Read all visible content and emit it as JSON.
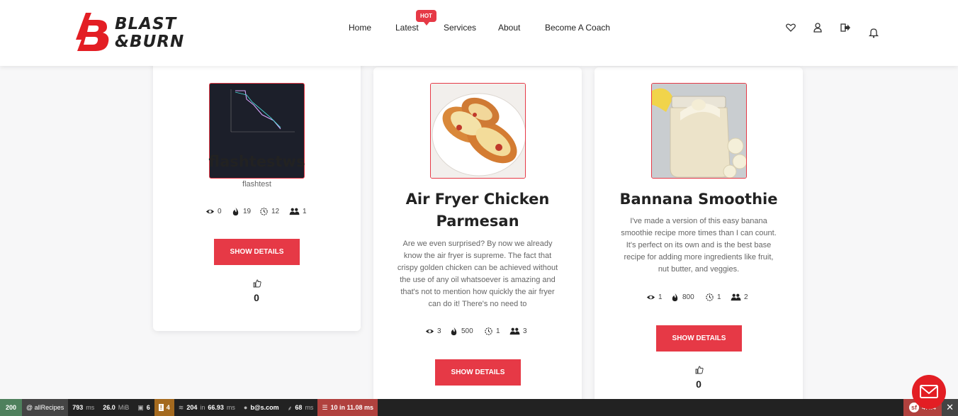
{
  "header": {
    "logo_text_1": "BLAST",
    "logo_text_2": "&BURN",
    "nav": [
      "Home",
      "Latest",
      "Services",
      "About",
      "Become A Coach"
    ],
    "hot_badge": "HOT",
    "icons": [
      "heart-icon",
      "user-icon",
      "logout-icon",
      "bell-icon"
    ]
  },
  "cards": [
    {
      "title": "flashtestws",
      "subtitle": "flashtest",
      "views": "0",
      "calories": "19",
      "time": "12",
      "people": "1",
      "button": "SHOW DETAILS",
      "likes": "0"
    },
    {
      "title_line1": "Air Fryer Chicken",
      "title_line2": "Parmesan",
      "desc": [
        "Are we even surprised? By now we already",
        "know the air fryer is supreme. The fact that",
        "crispy golden chicken can be achieved without",
        "the use of any oil whatsoever is amazing and",
        "that's not to mention how quickly the air fryer",
        "can do it! There's no need to"
      ],
      "views": "3",
      "calories": "500",
      "time": "1",
      "people": "3",
      "button": "SHOW DETAILS"
    },
    {
      "title": "Bannana Smoothie",
      "desc": [
        "I've made a version of this easy banana",
        "smoothie recipe more times than I can count.",
        "It's perfect on its own and is the best base",
        "recipe for adding more ingredients like fruit,",
        "nut butter, and veggies."
      ],
      "views": "1",
      "calories": "800",
      "time": "1",
      "people": "2",
      "button": "SHOW DETAILS",
      "likes": "0"
    }
  ],
  "debug": {
    "status": "200",
    "route": "@ allRecipes",
    "time": "793",
    "time_unit": "ms",
    "memory": "26.0",
    "memory_unit": "MiB",
    "forms": "6",
    "warnings": "4",
    "queries": "204",
    "queries_in": "in",
    "queries_time": "66.93",
    "queries_unit": "ms",
    "user": "b@s.com",
    "twig_time": "68",
    "twig_unit": "ms",
    "cache": "10 in 11.08 ms",
    "version": "4.4.4"
  },
  "colors": {
    "accent": "#e63946",
    "debug_ok": "#4f805d",
    "debug_warn": "#a46a1f",
    "debug_err": "#b0413e"
  }
}
